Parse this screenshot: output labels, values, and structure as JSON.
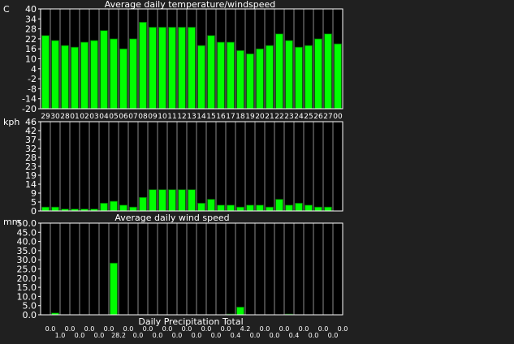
{
  "chart_data": [
    {
      "type": "bar",
      "title": "Average daily temperature/windspeed",
      "ylabel": "C",
      "ylim": [
        -20,
        40
      ],
      "yticks": [
        "40",
        "34",
        "28",
        "22",
        "16",
        "10",
        "4",
        "-2",
        "-8",
        "-14",
        "-20"
      ],
      "x_tick_labels": [
        "29",
        "30",
        "28",
        "01",
        "02",
        "03",
        "04",
        "05",
        "06",
        "07",
        "08",
        "09",
        "10",
        "11",
        "12",
        "13",
        "14",
        "15",
        "16",
        "17",
        "18",
        "19",
        "20",
        "21",
        "22",
        "23",
        "24",
        "25",
        "26",
        "27",
        "00"
      ],
      "values": [
        24,
        21,
        18,
        17,
        20,
        21,
        27,
        22,
        16,
        22,
        32,
        29,
        29,
        29,
        29,
        29,
        18,
        24,
        20,
        20,
        15,
        13,
        16,
        18,
        25,
        21,
        17,
        18,
        22,
        25,
        19
      ],
      "bar_color": "#00ff00",
      "grid": true
    },
    {
      "type": "bar",
      "title": "Average daily wind speed",
      "ylabel": "kph",
      "ylim": [
        0,
        46
      ],
      "yticks": [
        "46",
        "42",
        "37",
        "32",
        "28",
        "23",
        "19",
        "14",
        "9",
        "5",
        "0"
      ],
      "values": [
        2,
        2,
        1,
        1,
        1,
        1,
        4,
        5,
        3,
        2,
        7,
        11,
        11,
        11,
        11,
        11,
        4,
        6,
        3,
        3,
        2,
        3,
        3,
        2,
        6,
        3,
        4,
        3,
        2,
        2,
        0
      ],
      "bar_color": "#00ff00",
      "grid": true
    },
    {
      "type": "bar",
      "title": "Daily Precipitation Total",
      "ylabel": "mm",
      "ylim": [
        0,
        50
      ],
      "yticks": [
        "50.0",
        "45.0",
        "40.0",
        "35.0",
        "30.0",
        "25.0",
        "20.0",
        "15.0",
        "10.0",
        "5.0",
        "0.0"
      ],
      "values": [
        0.0,
        1.0,
        0.0,
        0.0,
        0.0,
        0.0,
        0.0,
        28.2,
        0.0,
        0.0,
        0.0,
        0.0,
        0.0,
        0.0,
        0.0,
        0.0,
        0.0,
        0.0,
        0.0,
        0.4,
        4.2,
        0.0,
        0.0,
        0.0,
        0.0,
        0.4,
        0.0,
        0.0,
        0.0,
        0.0,
        0.0
      ],
      "value_labels": [
        "0.0",
        "1.0",
        "0.0",
        "0.0",
        "0.0",
        "0.0",
        "0.0",
        "28.2",
        "0.0",
        "0.0",
        "0.0",
        "0.0",
        "0.0",
        "0.0",
        "0.0",
        "0.0",
        "0.0",
        "0.0",
        "0.0",
        "0.4",
        "4.2",
        "0.0",
        "0.0",
        "0.0",
        "0.0",
        "0.4",
        "0.0",
        "0.0",
        "0.0",
        "0.0",
        "0.0"
      ],
      "bar_color": "#00ff00",
      "grid": true
    }
  ]
}
